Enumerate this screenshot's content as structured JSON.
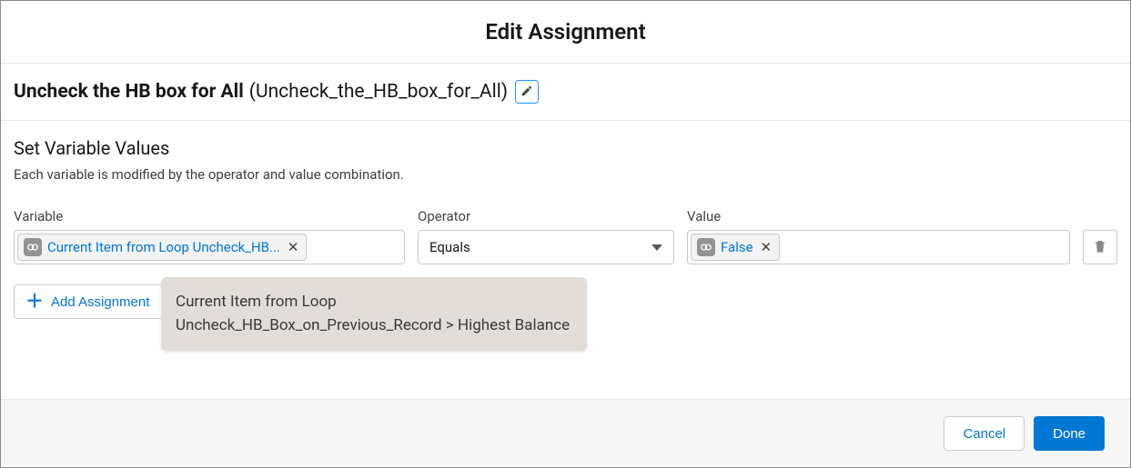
{
  "modal": {
    "title": "Edit Assignment"
  },
  "element": {
    "label": "Uncheck the HB box for All",
    "api_name": "(Uncheck_the_HB_box_for_All)"
  },
  "section": {
    "title": "Set Variable Values",
    "description": "Each variable is modified by the operator and value combination."
  },
  "columns": {
    "variable": "Variable",
    "operator": "Operator",
    "value": "Value"
  },
  "assignment": {
    "variable_display": "Current Item from Loop Uncheck_HB...",
    "variable_full": "Current Item from Loop Uncheck_HB_Box_on_Previous_Record > Highest Balance",
    "operator": "Equals",
    "value_display": "False"
  },
  "tooltip": {
    "text": "Current Item from Loop Uncheck_HB_Box_on_Previous_Record > Highest Balance"
  },
  "actions": {
    "add": "Add Assignment",
    "cancel": "Cancel",
    "done": "Done"
  }
}
